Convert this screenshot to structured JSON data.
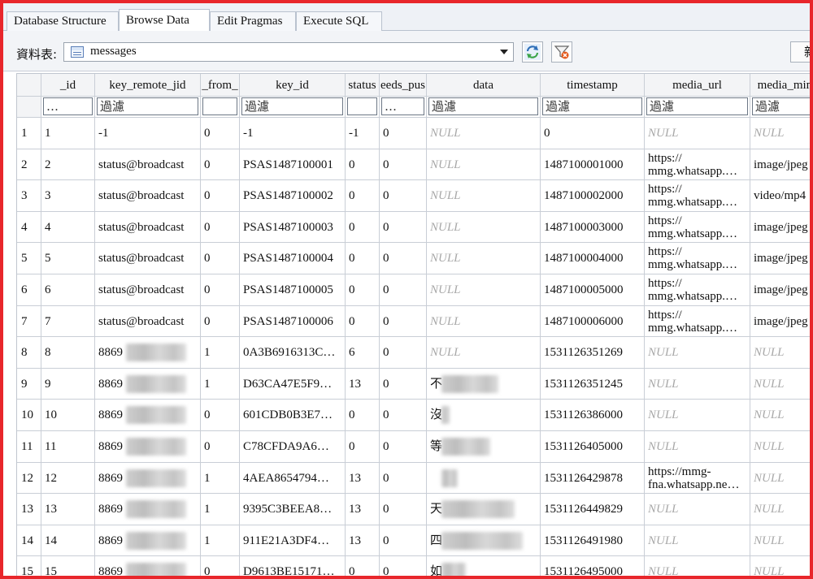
{
  "tabs": [
    {
      "label": "Database Structure",
      "active": false
    },
    {
      "label": "Browse Data",
      "active": true
    },
    {
      "label": "Edit Pragmas",
      "active": false
    },
    {
      "label": "Execute SQL",
      "active": false
    }
  ],
  "toolbar": {
    "table_label": "資料表:",
    "selected_table": "messages",
    "table_icon": "table-icon",
    "refresh_icon": "refresh-icon",
    "clear_filter_icon": "clear-filter-icon",
    "new_record_label": "新"
  },
  "grid": {
    "columns": [
      "_id",
      "key_remote_jid",
      "_from_",
      "key_id",
      "status",
      "eeds_pus",
      "data",
      "timestamp",
      "media_url",
      "media_mim"
    ],
    "filters": [
      "…",
      "過濾",
      "",
      "過濾",
      "",
      "…",
      "過濾",
      "過濾",
      "過濾",
      "過濾"
    ],
    "rows": [
      [
        "1",
        "1",
        "-1",
        "0",
        "-1",
        "-1",
        "0",
        "NULL",
        "0",
        "NULL",
        "NULL"
      ],
      [
        "2",
        "2",
        "status@broadcast",
        "0",
        "PSAS1487100001",
        "0",
        "0",
        "NULL",
        "1487100001000",
        "https://\nmmg.whatsapp.…",
        "image/jpeg"
      ],
      [
        "3",
        "3",
        "status@broadcast",
        "0",
        "PSAS1487100002",
        "0",
        "0",
        "NULL",
        "1487100002000",
        "https://\nmmg.whatsapp.…",
        "video/mp4"
      ],
      [
        "4",
        "4",
        "status@broadcast",
        "0",
        "PSAS1487100003",
        "0",
        "0",
        "NULL",
        "1487100003000",
        "https://\nmmg.whatsapp.…",
        "image/jpeg"
      ],
      [
        "5",
        "5",
        "status@broadcast",
        "0",
        "PSAS1487100004",
        "0",
        "0",
        "NULL",
        "1487100004000",
        "https://\nmmg.whatsapp.…",
        "image/jpeg"
      ],
      [
        "6",
        "6",
        "status@broadcast",
        "0",
        "PSAS1487100005",
        "0",
        "0",
        "NULL",
        "1487100005000",
        "https://\nmmg.whatsapp.…",
        "image/jpeg"
      ],
      [
        "7",
        "7",
        "status@broadcast",
        "0",
        "PSAS1487100006",
        "0",
        "0",
        "NULL",
        "1487100006000",
        "https://\nmmg.whatsapp.…",
        "image/jpeg"
      ],
      [
        "8",
        "8",
        "8869",
        "1",
        "0A3B6916313C…",
        "6",
        "0",
        "NULL",
        "1531126351269",
        "NULL",
        "NULL"
      ],
      [
        "9",
        "9",
        "8869",
        "1",
        "D63CA47E5F9…",
        "13",
        "0",
        "不",
        "1531126351245",
        "NULL",
        "NULL"
      ],
      [
        "10",
        "10",
        "8869",
        "0",
        "601CDB0B3E7…",
        "0",
        "0",
        "沒",
        "1531126386000",
        "NULL",
        "NULL"
      ],
      [
        "11",
        "11",
        "8869",
        "0",
        "C78CFDA9A6…",
        "0",
        "0",
        "等",
        "1531126405000",
        "NULL",
        "NULL"
      ],
      [
        "12",
        "12",
        "8869",
        "1",
        "4AEA8654794…",
        "13",
        "0",
        "",
        "1531126429878",
        "https://mmg-\nfna.whatsapp.ne…",
        "NULL"
      ],
      [
        "13",
        "13",
        "8869",
        "1",
        "9395C3BEEA8…",
        "13",
        "0",
        "天",
        "1531126449829",
        "NULL",
        "NULL"
      ],
      [
        "14",
        "14",
        "8869",
        "1",
        "911E21A3DF4…",
        "13",
        "0",
        "四",
        "1531126491980",
        "NULL",
        "NULL"
      ],
      [
        "15",
        "15",
        "8869",
        "0",
        "D9613BE15171…",
        "0",
        "0",
        "如",
        "1531126495000",
        "NULL",
        "NULL"
      ]
    ]
  },
  "colors": {
    "frame_border": "#e8262b",
    "null_text": "#a8a8a8",
    "header_bg": "#f3f4f6"
  }
}
